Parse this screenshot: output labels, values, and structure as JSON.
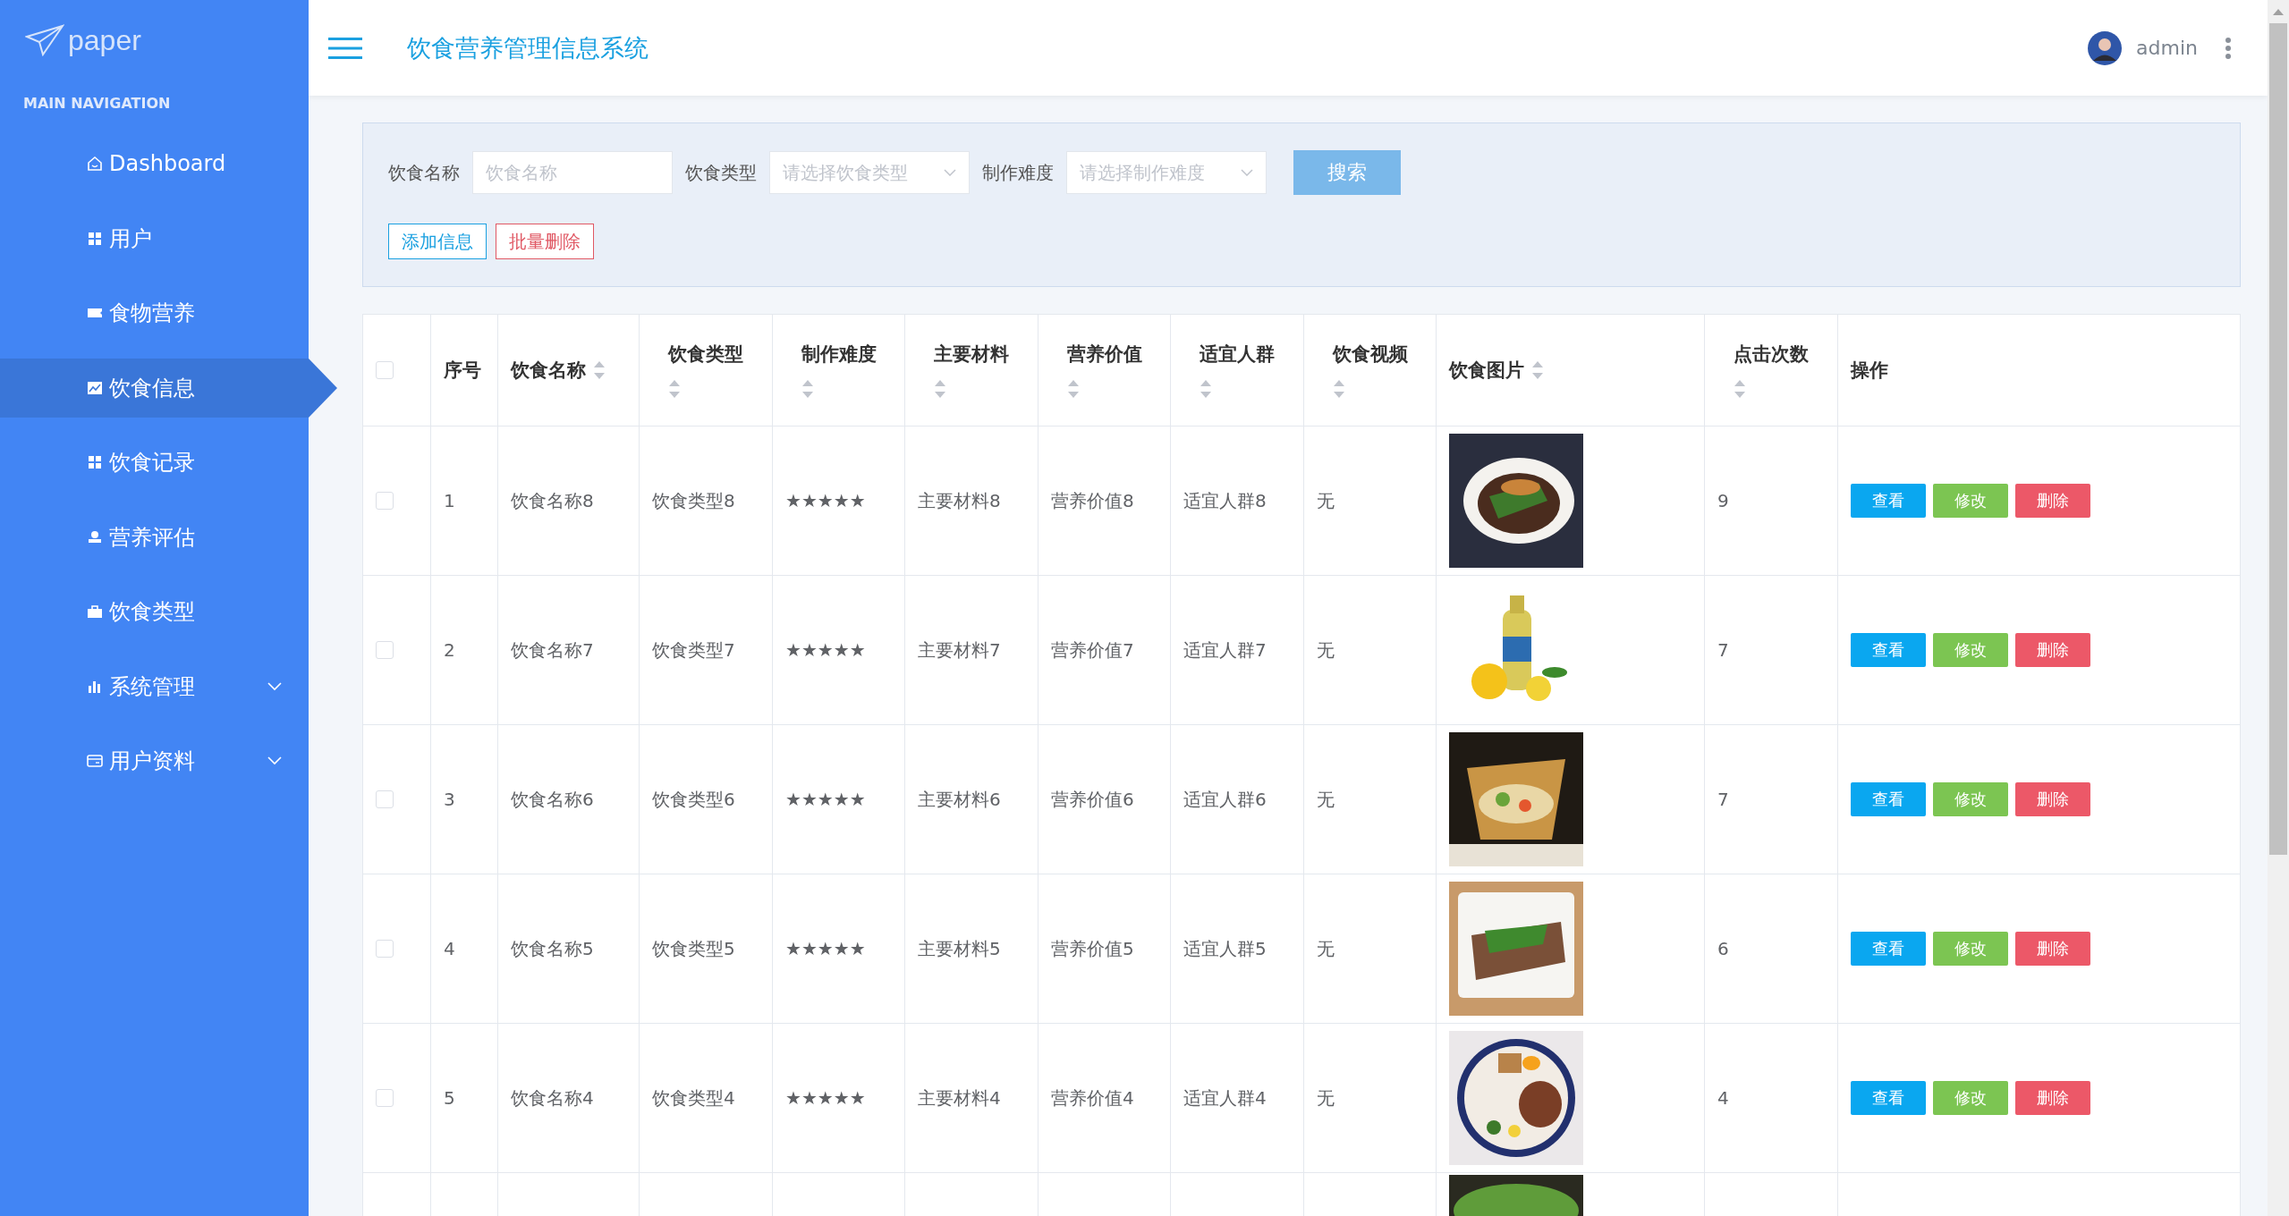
{
  "sidebar": {
    "logo": "paper",
    "section_title": "MAIN NAVIGATION",
    "items": [
      {
        "label": "Dashboard",
        "selected": false,
        "expandable": false
      },
      {
        "label": "用户",
        "selected": false,
        "expandable": false
      },
      {
        "label": "食物营养",
        "selected": false,
        "expandable": false
      },
      {
        "label": "饮食信息",
        "selected": true,
        "expandable": false
      },
      {
        "label": "饮食记录",
        "selected": false,
        "expandable": false
      },
      {
        "label": "营养评估",
        "selected": false,
        "expandable": false
      },
      {
        "label": "饮食类型",
        "selected": false,
        "expandable": false
      },
      {
        "label": "系统管理",
        "selected": false,
        "expandable": true
      },
      {
        "label": "用户资料",
        "selected": false,
        "expandable": true
      }
    ]
  },
  "header": {
    "title": "饮食营养管理信息系统",
    "user": "admin"
  },
  "search": {
    "fields": [
      {
        "label": "饮食名称",
        "kind": "input",
        "placeholder": "饮食名称"
      },
      {
        "label": "饮食类型",
        "kind": "select",
        "placeholder": "请选择饮食类型"
      },
      {
        "label": "制作难度",
        "kind": "select",
        "placeholder": "请选择制作难度"
      }
    ],
    "search_button": "搜索",
    "add_button": "添加信息",
    "delete_button": "批量删除"
  },
  "table": {
    "select_all_checked": false,
    "columns": [
      {
        "label": "序号",
        "sortable": false
      },
      {
        "label": "饮食名称",
        "sortable": true
      },
      {
        "label": "饮食类型",
        "sortable": true
      },
      {
        "label": "制作难度",
        "sortable": true
      },
      {
        "label": "主要材料",
        "sortable": true
      },
      {
        "label": "营养价值",
        "sortable": true
      },
      {
        "label": "适宜人群",
        "sortable": true
      },
      {
        "label": "饮食视频",
        "sortable": true
      },
      {
        "label": "饮食图片",
        "sortable": true
      },
      {
        "label": "点击次数",
        "sortable": true
      },
      {
        "label": "操作",
        "sortable": false
      }
    ],
    "rows": [
      {
        "checked": false,
        "cells": [
          "1",
          "饮食名称8",
          "饮食类型8",
          "★★★★★",
          "主要材料8",
          "营养价值8",
          "适宜人群8",
          "无"
        ],
        "image": {
          "kind": "picture"
        },
        "clicks": "9",
        "actions": [
          "查看",
          "修改",
          "删除"
        ]
      },
      {
        "checked": false,
        "cells": [
          "2",
          "饮食名称7",
          "饮食类型7",
          "★★★★★",
          "主要材料7",
          "营养价值7",
          "适宜人群7",
          "无"
        ],
        "image": {
          "kind": "picture"
        },
        "clicks": "7",
        "actions": [
          "查看",
          "修改",
          "删除"
        ]
      },
      {
        "checked": false,
        "cells": [
          "3",
          "饮食名称6",
          "饮食类型6",
          "★★★★★",
          "主要材料6",
          "营养价值6",
          "适宜人群6",
          "无"
        ],
        "image": {
          "kind": "picture"
        },
        "clicks": "7",
        "actions": [
          "查看",
          "修改",
          "删除"
        ]
      },
      {
        "checked": false,
        "cells": [
          "4",
          "饮食名称5",
          "饮食类型5",
          "★★★★★",
          "主要材料5",
          "营养价值5",
          "适宜人群5",
          "无"
        ],
        "image": {
          "kind": "picture"
        },
        "clicks": "6",
        "actions": [
          "查看",
          "修改",
          "删除"
        ]
      },
      {
        "checked": false,
        "cells": [
          "5",
          "饮食名称4",
          "饮食类型4",
          "★★★★★",
          "主要材料4",
          "营养价值4",
          "适宜人群4",
          "无"
        ],
        "image": {
          "kind": "picture"
        },
        "clicks": "4",
        "actions": [
          "查看",
          "修改",
          "删除"
        ]
      }
    ],
    "partial_row": {
      "image": {
        "kind": "picture"
      }
    }
  }
}
